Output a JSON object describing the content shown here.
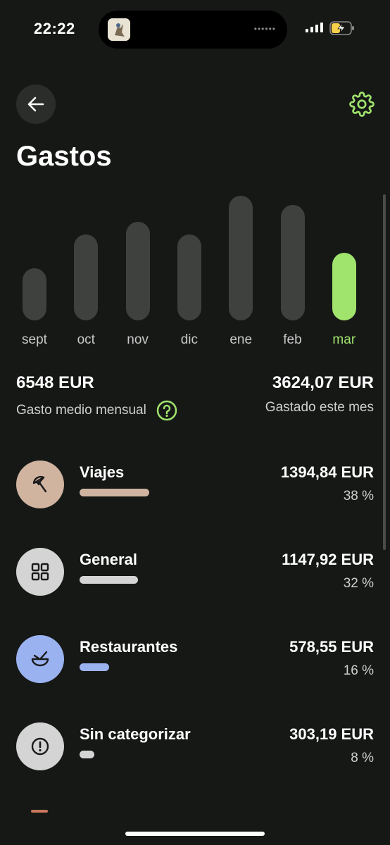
{
  "status": {
    "time": "22:22"
  },
  "header": {
    "title": "Gastos"
  },
  "chart_data": {
    "type": "bar",
    "categories": [
      "sept",
      "oct",
      "nov",
      "dic",
      "ene",
      "feb",
      "mar"
    ],
    "values": [
      2800,
      4600,
      5300,
      4600,
      6700,
      6200,
      3624.07
    ],
    "highlighted": "mar",
    "ylim": [
      0,
      7000
    ],
    "colors": {
      "bar": "#3f413f",
      "active": "#a0e36d"
    }
  },
  "summary": {
    "average_value": "6548 EUR",
    "average_label": "Gasto medio mensual",
    "month_value": "3624,07 EUR",
    "month_label": "Gastado este mes"
  },
  "categories": [
    {
      "name": "Viajes",
      "amount": "1394,84 EUR",
      "percent": "38 %",
      "share": 0.38,
      "color": "#d0b4a0",
      "icon": "umbrella-icon"
    },
    {
      "name": "General",
      "amount": "1147,92 EUR",
      "percent": "32 %",
      "share": 0.32,
      "color": "#d3d4d3",
      "icon": "grid-icon"
    },
    {
      "name": "Restaurantes",
      "amount": "578,55 EUR",
      "percent": "16 %",
      "share": 0.16,
      "color": "#9bb2f0",
      "icon": "bowl-icon"
    },
    {
      "name": "Sin categorizar",
      "amount": "303,19 EUR",
      "percent": "8 %",
      "share": 0.08,
      "color": "#d3d4d3",
      "icon": "alert-icon"
    }
  ],
  "colors": {
    "accent": "#a0e36d",
    "background": "#161816"
  }
}
